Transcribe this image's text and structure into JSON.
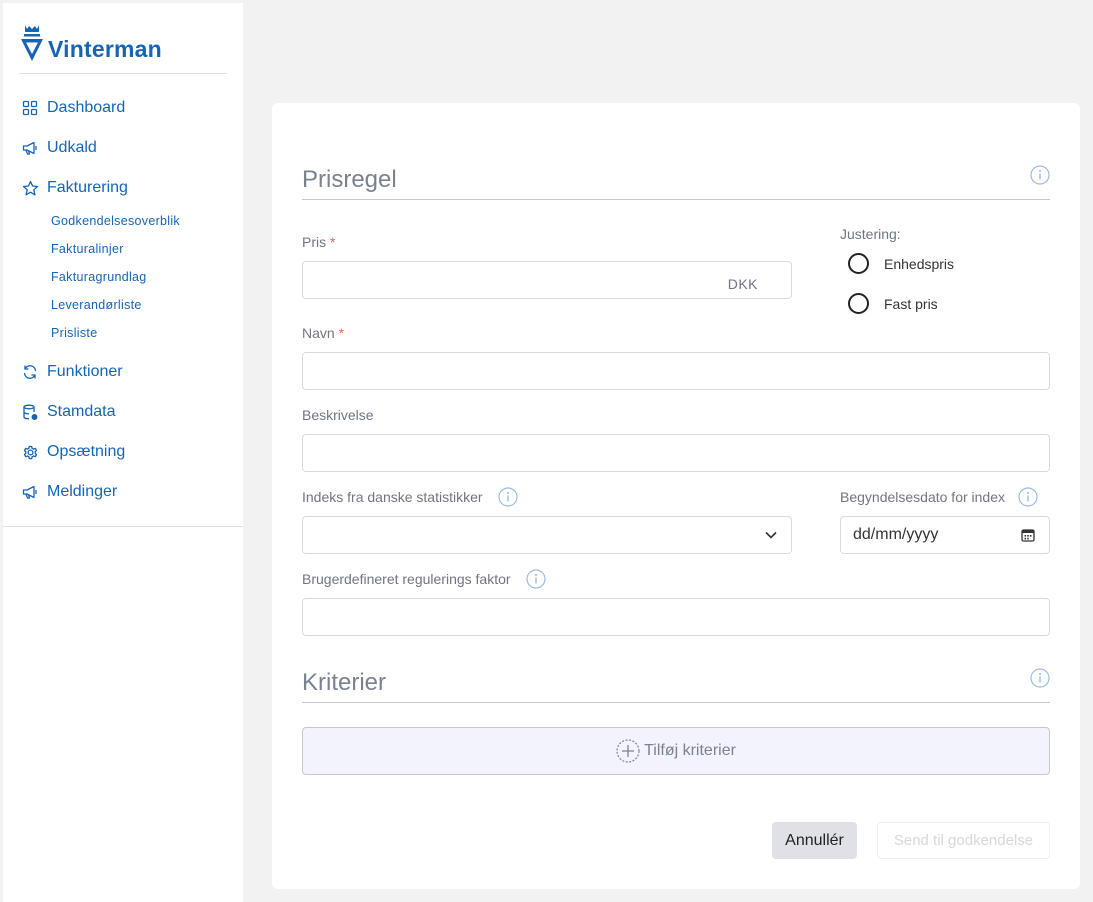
{
  "brand": {
    "name": "Vinterman",
    "color": "#1565b5"
  },
  "sidebar": {
    "items": [
      {
        "label": "Dashboard",
        "icon": "grid-icon"
      },
      {
        "label": "Udkald",
        "icon": "megaphone-icon"
      },
      {
        "label": "Fakturering",
        "icon": "star-icon"
      },
      {
        "label": "Funktioner",
        "icon": "refresh-icon"
      },
      {
        "label": "Stamdata",
        "icon": "database-icon"
      },
      {
        "label": "Opsætning",
        "icon": "gear-icon"
      },
      {
        "label": "Meldinger",
        "icon": "megaphone-icon"
      }
    ],
    "subitems": [
      "Godkendelsesoverblik",
      "Fakturalinjer",
      "Fakturagrundlag",
      "Leverandørliste",
      "Prisliste"
    ]
  },
  "form": {
    "section_title": "Prisregel",
    "pris_label": "Pris",
    "required_mark": "*",
    "pris_value": "",
    "currency": "DKK",
    "justering_label": "Justering:",
    "justering_options": [
      "Enhedspris",
      "Fast pris"
    ],
    "navn_label": "Navn",
    "navn_value": "",
    "beskrivelse_label": "Beskrivelse",
    "beskrivelse_value": "",
    "indeks_label": "Indeks fra danske statistikker",
    "indeks_value": "",
    "begyndelsesdato_label": "Begyndelsesdato for index",
    "begyndelsesdato_value": "dd/mm/yyyy",
    "faktor_label": "Brugerdefineret regulerings faktor",
    "faktor_value": ""
  },
  "criteria": {
    "section_title": "Kriterier",
    "add_label": "Tilføj kriterier"
  },
  "actions": {
    "cancel_label": "Annullér",
    "send_label": "Send til godkendelse"
  }
}
